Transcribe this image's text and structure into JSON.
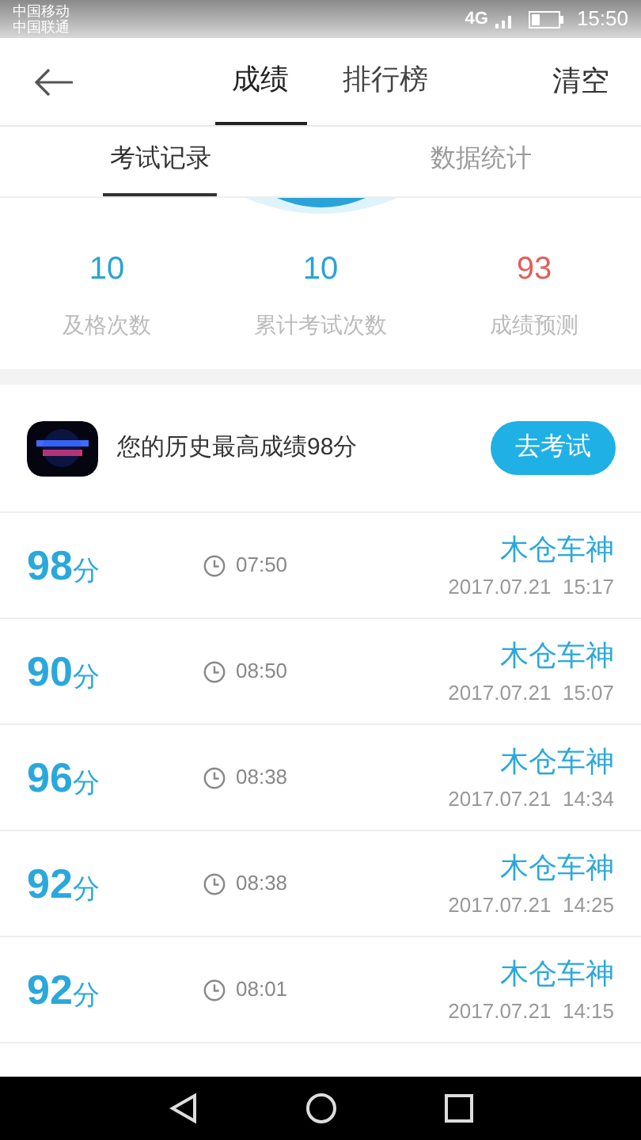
{
  "status_bar": {
    "carriers": [
      "中国移动",
      "中国联通"
    ],
    "network": "4G",
    "time": "15:50"
  },
  "header": {
    "tabs": [
      {
        "label": "成绩",
        "selected": true
      },
      {
        "label": "排行榜",
        "selected": false
      }
    ],
    "action": "清空"
  },
  "sub_tabs": [
    {
      "label": "考试记录",
      "selected": true
    },
    {
      "label": "数据统计",
      "selected": false
    }
  ],
  "stats": [
    {
      "value": "10",
      "label": "及格次数",
      "color": "#2aa3d8"
    },
    {
      "value": "10",
      "label": "累计考试次数",
      "color": "#2aa3d8"
    },
    {
      "value": "93",
      "label": "成绩预测",
      "color": "#e0605a"
    }
  ],
  "best": {
    "text": "您的历史最高成绩98分",
    "button": "去考试"
  },
  "records": [
    {
      "score": "98",
      "unit": "分",
      "duration": "07:50",
      "name": "木仓车神",
      "date": "2017.07.21",
      "time": "15:17"
    },
    {
      "score": "90",
      "unit": "分",
      "duration": "08:50",
      "name": "木仓车神",
      "date": "2017.07.21",
      "time": "15:07"
    },
    {
      "score": "96",
      "unit": "分",
      "duration": "08:38",
      "name": "木仓车神",
      "date": "2017.07.21",
      "time": "14:34"
    },
    {
      "score": "92",
      "unit": "分",
      "duration": "08:38",
      "name": "木仓车神",
      "date": "2017.07.21",
      "time": "14:25"
    },
    {
      "score": "92",
      "unit": "分",
      "duration": "08:01",
      "name": "木仓车神",
      "date": "2017.07.21",
      "time": "14:15"
    }
  ]
}
